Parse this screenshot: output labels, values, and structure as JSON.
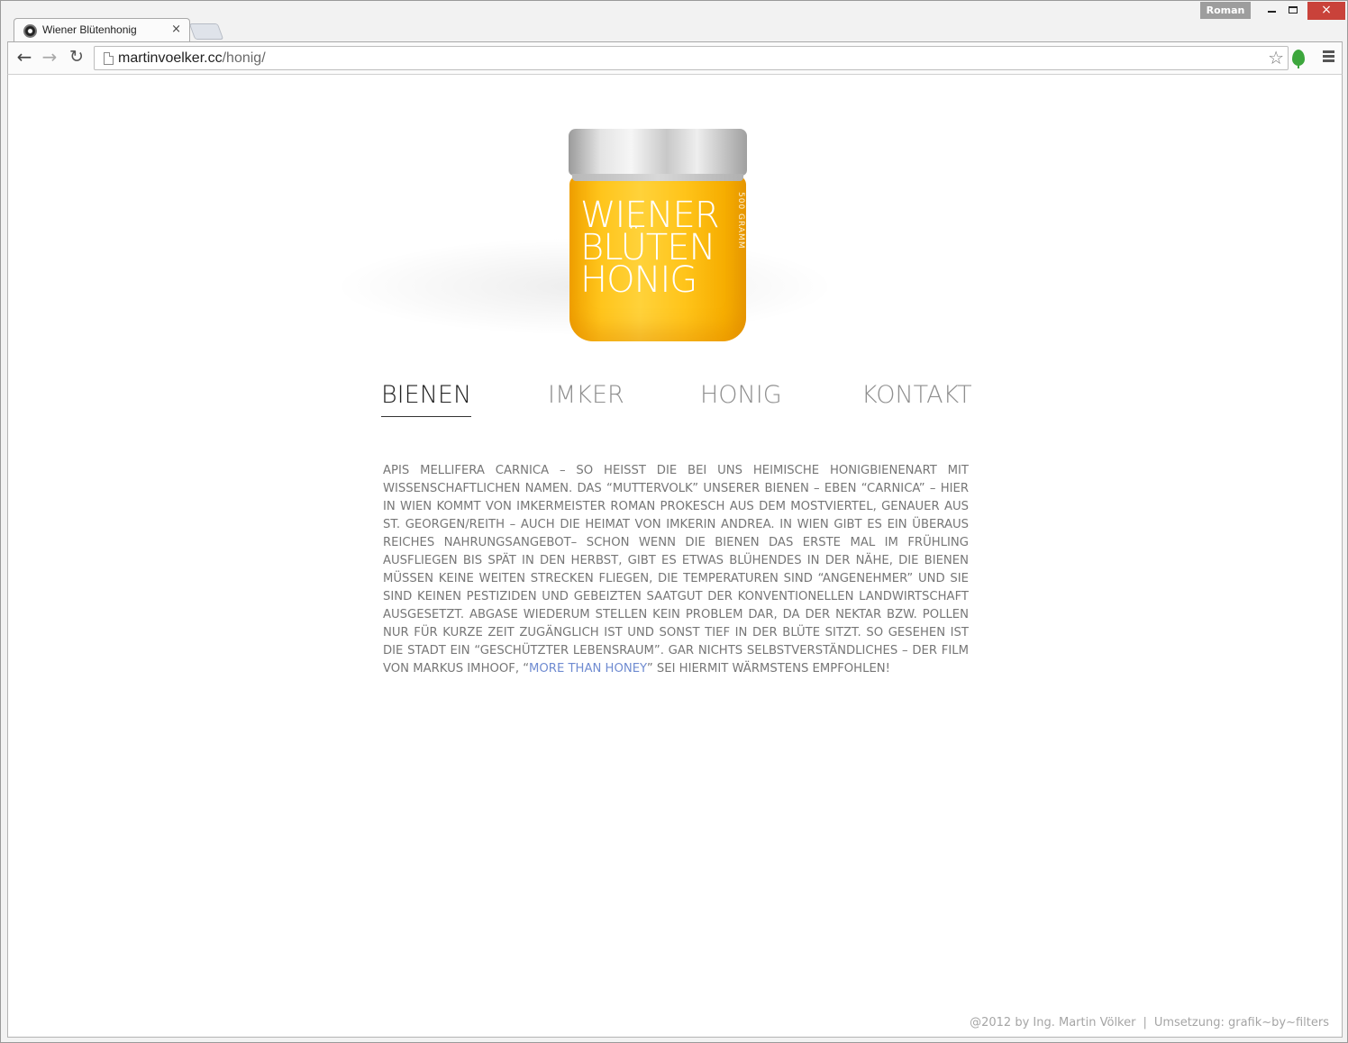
{
  "window": {
    "profile_name": "Roman",
    "controls": {
      "minimize": "minimize-icon",
      "maximize": "maximize-icon",
      "close": "×"
    }
  },
  "tab": {
    "title": "Wiener Blütenhonig",
    "close": "×",
    "favicon": "eye-favicon-icon"
  },
  "toolbar": {
    "back": "←",
    "forward": "→",
    "reload": "↻",
    "url_host": "martinvoelker.cc",
    "url_path": "/honig/",
    "star": "☆"
  },
  "hero": {
    "label_lines": [
      "WIENER",
      "BLÜTEN",
      "HONIG"
    ],
    "side_text": "500 GRAMM"
  },
  "nav": {
    "items": [
      {
        "label": "BIENEN",
        "active": true
      },
      {
        "label": "IMKER",
        "active": false
      },
      {
        "label": "HONIG",
        "active": false
      },
      {
        "label": "KONTAKT",
        "active": false
      }
    ]
  },
  "content": {
    "text_before_link": "Apis mellifera carnica – so heißt die bei uns heimische Honigbienenart mit wissenschaftlichen Namen. Das “Muttervolk” unserer Bienen – eben “Carnica” – hier in Wien kommt von Imkermeister Roman Prokesch aus dem Mostviertel, genauer aus St. Georgen/Reith – auch die Heimat von Imkerin Andrea. In Wien gibt es ein überaus reiches Nahrungsangebot– schon wenn die Bienen das erste Mal im Frühling ausfliegen bis spät in den Herbst, gibt es etwas Blühendes in der Nähe, die Bienen müssen keine weiten Strecken fliegen, die Temperaturen sind “angenehmer” und sie sind keinen Pestiziden und gebeizten Saatgut der konventionellen Landwirtschaft ausgesetzt. Abgase wiederum stellen kein Problem dar, da der Nektar bzw. Pollen nur für kurze Zeit zugänglich ist und sonst tief in der Blüte sitzt. So gesehen ist die Stadt ein “geschützter Lebensraum”. Gar nichts selbstverständliches – der Film von Markus Imhoof, “",
    "link_text": "More than Honey",
    "text_after_link": "” sei hiermit wärmstens empfohlen!"
  },
  "footer": {
    "copyright": "@2012 by Ing. Martin Völker",
    "separator": "|",
    "credit": "Umsetzung: grafik~by~filters"
  },
  "colors": {
    "jar_honey": "#ffc51c",
    "nav_active": "#222222",
    "nav_inactive": "#8f8f8f",
    "body_text": "#767676",
    "link": "#6f8bd1",
    "close_button": "#c9423a"
  }
}
